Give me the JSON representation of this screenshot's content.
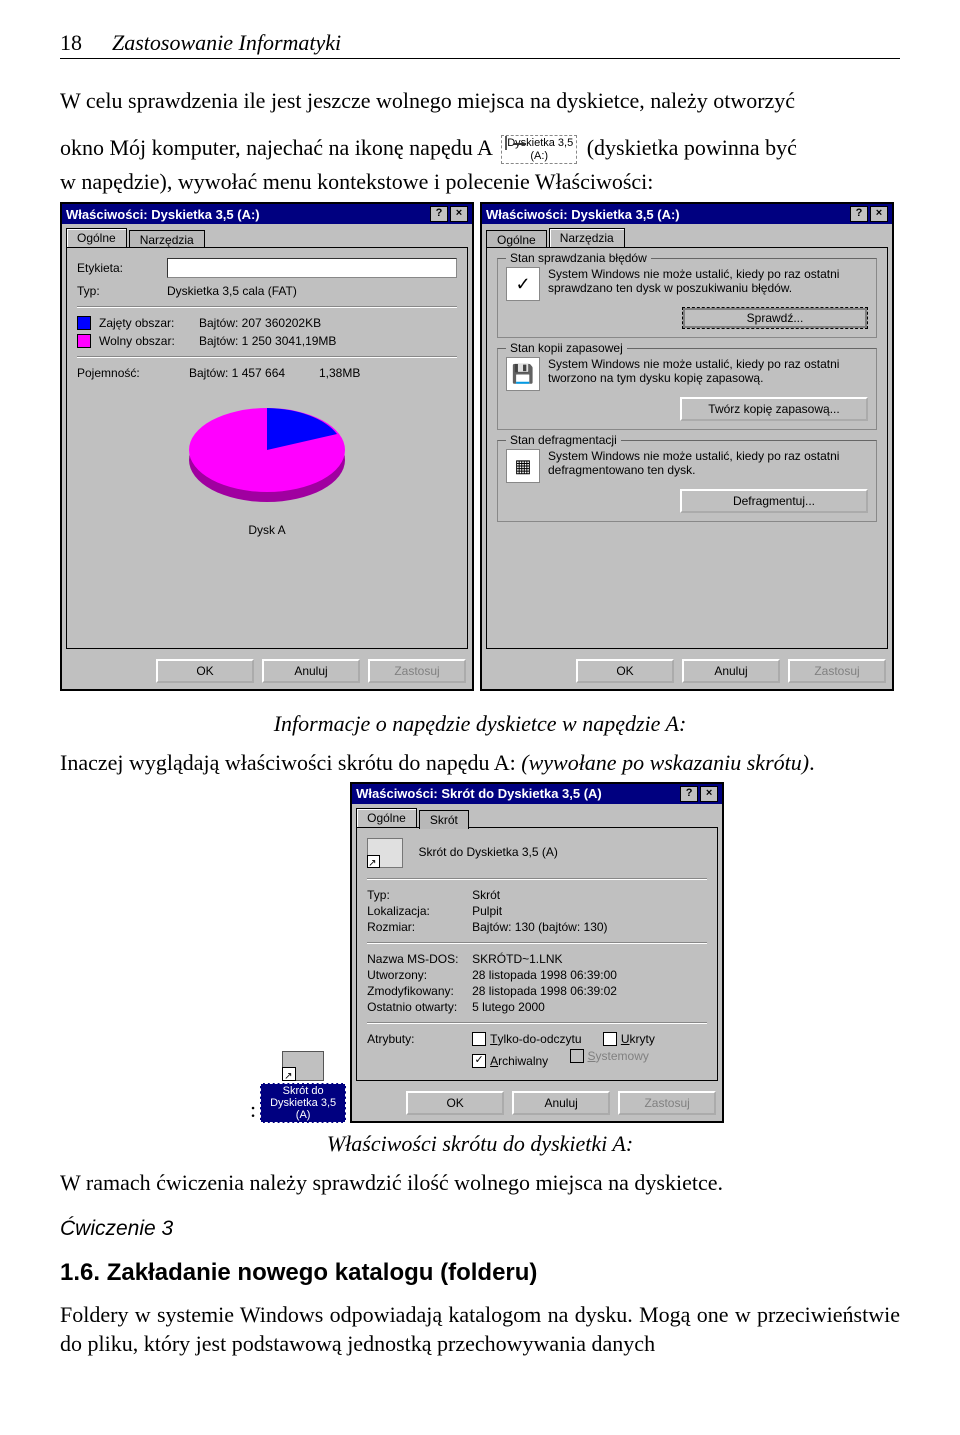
{
  "header": {
    "page_number": "18",
    "title": "Zastosowanie Informatyki"
  },
  "intro": {
    "line1": "W celu sprawdzenia ile jest jeszcze wolnego miejsca na dyskietce, należy otworzyć",
    "line2a": "okno Mój komputer, najechać na ikonę napędu A",
    "line2b": "(dyskietka powinna być",
    "drive_icon_label1": "Dyskietka 3,5",
    "drive_icon_label2": "(A:)",
    "line3": "w napędzie), wywołać menu kontekstowe i polecenie Właściwości:"
  },
  "dialogA": {
    "title": "Właściwości: Dyskietka 3,5 (A:)",
    "help": "?",
    "close": "×",
    "tab1": "Ogólne",
    "tab2": "Narzędzia",
    "etykieta": "Etykieta:",
    "typ": "Typ:",
    "typ_val": "Dyskietka 3,5 cala (FAT)",
    "used": "Zajęty obszar:",
    "used_bytes": "Bajtów: 207 360",
    "used_kb": "202KB",
    "free": "Wolny obszar:",
    "free_bytes": "Bajtów: 1 250 304",
    "free_mb": "1,19MB",
    "cap": "Pojemność:",
    "cap_bytes": "Bajtów: 1 457 664",
    "cap_mb": "1,38MB",
    "pie_label": "Dysk A",
    "ok": "OK",
    "cancel": "Anuluj",
    "apply": "Zastosuj"
  },
  "dialogB": {
    "title": "Właściwości: Dyskietka 3,5 (A:)",
    "tab1": "Ogólne",
    "tab2": "Narzędzia",
    "g1_title": "Stan sprawdzania błędów",
    "g1_text": "System Windows nie może ustalić, kiedy po raz ostatni sprawdzano ten dysk w poszukiwaniu błędów.",
    "g1_btn": "Sprawdź...",
    "g2_title": "Stan kopii zapasowej",
    "g2_text": "System Windows nie może ustalić, kiedy po raz ostatni tworzono na tym dysku kopię zapasową.",
    "g2_btn": "Twórz kopię zapasową...",
    "g3_title": "Stan defragmentacji",
    "g3_text": "System Windows nie może ustalić, kiedy po raz ostatni defragmentowano ten dysk.",
    "g3_btn": "Defragmentuj...",
    "ok": "OK",
    "cancel": "Anuluj",
    "apply": "Zastosuj"
  },
  "caption1": "Informacje o napędzie dyskietce w napędzie A:",
  "para2a": "Inaczej wyglądają właściwości skrótu do napędu A: ",
  "para2b": "(wywołane po wskazaniu skrótu)",
  "para2c": ".",
  "desktop_shortcut": {
    "label": "Skrót do Dyskietka 3,5 (A)"
  },
  "dialogC": {
    "title": "Właściwości: Skrót do Dyskietka 3,5 (A)",
    "help": "?",
    "close": "×",
    "tab1": "Ogólne",
    "tab2": "Skrót",
    "name": "Skrót do Dyskietka 3,5 (A)",
    "typ_k": "Typ:",
    "typ_v": "Skrót",
    "lok_k": "Lokalizacja:",
    "lok_v": "Pulpit",
    "roz_k": "Rozmiar:",
    "roz_v": "Bajtów: 130 (bajtów: 130)",
    "dos_k": "Nazwa MS-DOS:",
    "dos_v": "SKRÓTD~1.LNK",
    "utw_k": "Utworzony:",
    "utw_v": "28 listopada 1998 06:39:00",
    "zm_k": "Zmodyfikowany:",
    "zm_v": "28 listopada 1998 06:39:02",
    "ost_k": "Ostatnio otwarty:",
    "ost_v": "5 lutego 2000",
    "attr": "Atrybuty:",
    "chk_ro": "Tylko-do-odczytu",
    "chk_hidden": "Ukryty",
    "chk_arch": "Archiwalny",
    "chk_sys": "Systemowy",
    "ok": "OK",
    "cancel": "Anuluj",
    "apply": "Zastosuj"
  },
  "caption2": "Właściwości skrótu do dyskietki A:",
  "para3": "W ramach ćwiczenia należy sprawdzić ilość wolnego miejsca na dyskietce.",
  "exercise": "Ćwiczenie 3",
  "section": "1.6. Zakładanie nowego katalogu (folderu)",
  "para4": "Foldery w systemie Windows odpowiadają katalogom na dysku. Mogą one w przeciwieństwie do pliku, który jest podstawową jednostką przechowywania danych",
  "chart_data": {
    "type": "pie",
    "title": "Dysk A",
    "series": [
      {
        "name": "Zajęty obszar",
        "value": 207360,
        "color": "#0000ff",
        "label": "202KB"
      },
      {
        "name": "Wolny obszar",
        "value": 1250304,
        "color": "#ff00ff",
        "label": "1,19MB"
      }
    ],
    "total": {
      "name": "Pojemność",
      "value": 1457664,
      "label": "1,38MB"
    }
  },
  "colon": ":"
}
